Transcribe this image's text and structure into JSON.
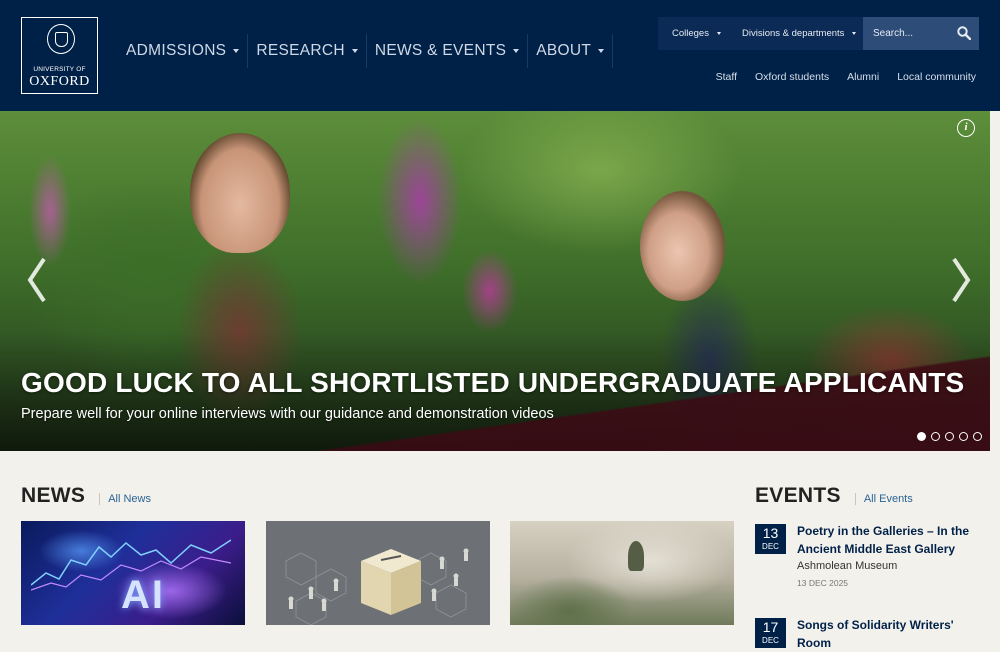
{
  "logo": {
    "line1": "UNIVERSITY OF",
    "line2": "OXFORD"
  },
  "nav": {
    "items": [
      {
        "label": "ADMISSIONS"
      },
      {
        "label": "RESEARCH"
      },
      {
        "label": "NEWS & EVENTS"
      },
      {
        "label": "ABOUT"
      }
    ]
  },
  "utility": {
    "colleges": "Colleges",
    "divisions": "Divisions & departments",
    "search_placeholder": "Search...",
    "search_icon": "search-icon"
  },
  "quicklinks": [
    "Staff",
    "Oxford students",
    "Alumni",
    "Local community"
  ],
  "hero": {
    "title": "GOOD LUCK TO ALL SHORTLISTED UNDERGRADUATE APPLICANTS",
    "subtitle": "Prepare well for your online interviews with our guidance and demonstration videos",
    "info": "i",
    "slide_count": 5,
    "active_slide": 1
  },
  "news": {
    "title": "NEWS",
    "link": "All News",
    "image1_text": "AI"
  },
  "events": {
    "title": "EVENTS",
    "link": "All Events",
    "items": [
      {
        "day": "13",
        "month": "DEC",
        "title": "Poetry in the Galleries – In the Ancient Middle East Gallery",
        "venue": "Ashmolean Museum",
        "date": "13 DEC 2025"
      },
      {
        "day": "17",
        "month": "DEC",
        "title": "Songs of Solidarity Writers' Room",
        "venue": "",
        "date": ""
      }
    ]
  },
  "colors": {
    "header": "#002147",
    "page_bg": "#f3f1ec",
    "link": "#2a6496"
  }
}
